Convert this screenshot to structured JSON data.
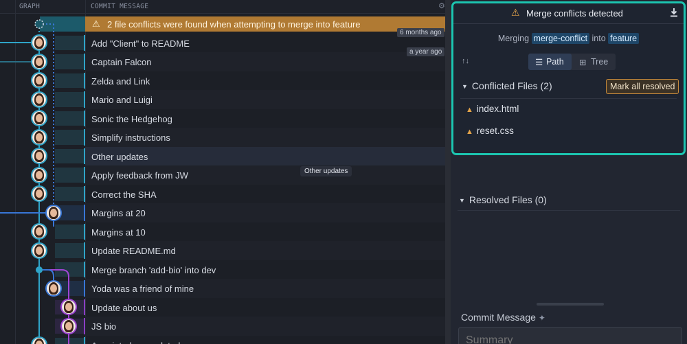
{
  "header": {
    "graph_label": "GRAPH",
    "commit_message_label": "COMMIT MESSAGE"
  },
  "conflict_banner": {
    "text": "2 file conflicts were found when attempting to merge into feature",
    "icon": "warning-icon"
  },
  "timestamps": [
    "6 months ago",
    "a year ago"
  ],
  "commits": [
    {
      "message": "Add \"Client\" to README"
    },
    {
      "message": "Captain Falcon"
    },
    {
      "message": "Zelda and Link"
    },
    {
      "message": "Mario and Luigi"
    },
    {
      "message": "Sonic the Hedgehog"
    },
    {
      "message": "Simplify instructions"
    },
    {
      "message": "Other updates"
    },
    {
      "message": "Apply feedback from JW"
    },
    {
      "message": "Correct the SHA"
    },
    {
      "message": "Margins at 20"
    },
    {
      "message": "Margins at 10"
    },
    {
      "message": "Update README.md"
    },
    {
      "message": "Merge branch 'add-bio' into dev"
    },
    {
      "message": "Yoda was a friend of mine"
    },
    {
      "message": "Update about us"
    },
    {
      "message": "JS bio"
    },
    {
      "message": "Appointed new related"
    }
  ],
  "tooltip": "Other updates",
  "merge_panel": {
    "title": "Merge conflicts detected",
    "merging_prefix": "Merging",
    "source_branch": "merge-conflict",
    "into_word": "into",
    "target_branch": "feature",
    "view_path": "Path",
    "view_tree": "Tree",
    "conflicted_header": "Conflicted Files (2)",
    "mark_all_resolved": "Mark all resolved",
    "conflicted_files": [
      "index.html",
      "reset.css"
    ],
    "resolved_header": "Resolved Files (0)"
  },
  "commit_panel": {
    "label": "Commit Message",
    "summary_placeholder": "Summary"
  },
  "colors": {
    "accent_teal": "#1cc5b0",
    "branch_teal": "#2fa4c8",
    "branch_blue": "#3876d6",
    "branch_purple": "#a045d4",
    "warning_orange": "#b07a33"
  }
}
